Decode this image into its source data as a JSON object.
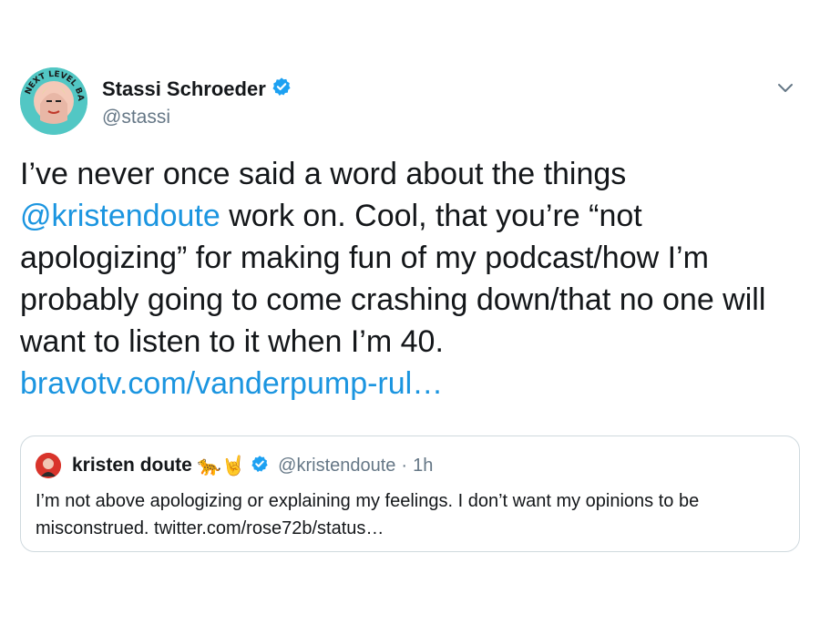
{
  "tweet": {
    "author": {
      "display_name": "Stassi Schroeder",
      "handle": "@stassi",
      "avatar_text": "NEXT LEVEL BASIC",
      "verified_icon": "verified-badge-icon"
    },
    "menu_icon": "chevron-down-icon",
    "body": {
      "mention": "@kristendoute",
      "text_before": "I’ve never once said a word about the things ",
      "text_after": " work on. Cool, that you’re “not apologizing” for making fun of my podcast/how I’m probably going to come crashing down/that no one will want to listen to it when I’m 40.",
      "link": "bravotv.com/vanderpump-rul…"
    },
    "quoted": {
      "display_name": "kristen doute",
      "emojis": "🐆🤘",
      "handle": "@kristendoute",
      "separator": "·",
      "time": "1h",
      "text": "I’m not above apologizing or explaining my feelings. I don’t want my opinions to be misconstrued. twitter.com/rose72b/status…"
    },
    "colors": {
      "link": "#1b95e0",
      "secondary_text": "#657786",
      "verified": "#1da1f2",
      "border": "#cfd9de"
    }
  }
}
